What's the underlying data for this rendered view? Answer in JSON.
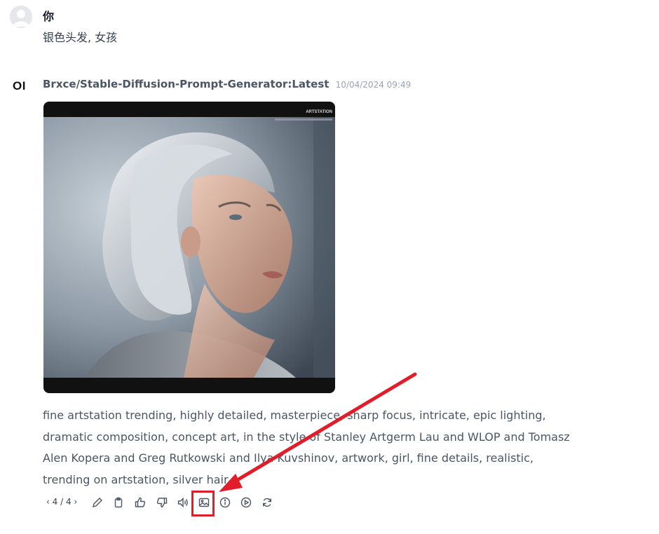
{
  "user_message": {
    "sender": "你",
    "text": "银色头发, 女孩"
  },
  "assistant_message": {
    "logo": "OI",
    "model": "Brxce/Stable-Diffusion-Prompt-Generator:Latest",
    "timestamp": "10/04/2024 09:49",
    "image_watermark": "ARTSTATION",
    "prompt": "fine artstation trending, highly detailed, masterpiece, sharp focus, intricate, epic lighting, dramatic composition, concept art, in the style of Stanley Artgerm Lau and WLOP and Tomasz Alen Kopera and Greg Rutkowski and Ilya Kuvshinov, artwork, girl, fine details, realistic, trending on artstation, silver hair"
  },
  "toolbar": {
    "prev_icon": "chevron-left-icon",
    "pager": "4 / 4",
    "next_icon": "chevron-right-icon",
    "actions": [
      "edit-icon",
      "copy-icon",
      "thumbs-up-icon",
      "thumbs-down-icon",
      "speaker-icon",
      "image-icon",
      "info-icon",
      "play-icon",
      "regenerate-icon"
    ]
  },
  "annotation": {
    "highlight_color": "#e11d2a",
    "highlighted_action": "image-icon"
  }
}
